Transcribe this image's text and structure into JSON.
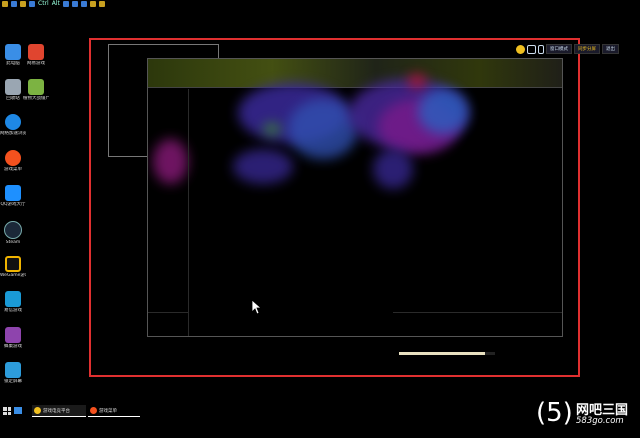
{
  "top_toolbar": {
    "text_ctrl": "Ctrl",
    "text_alt": "Alt"
  },
  "desktop_icons": [
    {
      "label": "此电脑",
      "icon": "computer-icon",
      "color": "#3a8ee6"
    },
    {
      "label": "网易游戏",
      "icon": "game-platform-icon",
      "color": "#e0452f"
    },
    {
      "label": "回收站",
      "icon": "recycle-bin-icon",
      "color": "#9aa6b2"
    },
    {
      "label": "植物大战僵尸",
      "icon": "plants-vs-zombies-icon",
      "color": "#7cb342"
    },
    {
      "label": "网络加速浏览器",
      "icon": "browser-icon",
      "color": "#1e88e5"
    },
    {
      "label": "游戏菜单",
      "icon": "game-menu-icon",
      "color": "#f4511e"
    },
    {
      "label": "QQ游戏大厅",
      "icon": "qq-icon",
      "color": "#1e90ff"
    },
    {
      "label": "Steam",
      "icon": "steam-icon",
      "color": "#1b2838"
    },
    {
      "label": "WeGame游戏平台",
      "icon": "wegame-icon",
      "color": "#f0b400"
    },
    {
      "label": "易信游戏",
      "icon": "yixin-icon",
      "color": "#1a9ad6"
    },
    {
      "label": "蜂巢游戏",
      "icon": "hive-game-icon",
      "color": "#8e44ad"
    },
    {
      "label": "锁定屏幕",
      "icon": "lock-icon",
      "color": "#2d9cdb"
    }
  ],
  "overlay_toolbar": {
    "btn_mode": "窗口模式",
    "btn_sync": "同步分屏",
    "btn_exit": "退出"
  },
  "progress": {
    "fraction": 0.9
  },
  "taskbar": {
    "items": [
      {
        "label": "游戏电竞平台",
        "icon": "game-platform-icon",
        "color": "#f0c020"
      },
      {
        "label": "游戏菜单",
        "icon": "game-menu-icon",
        "color": "#f4511e"
      }
    ]
  },
  "watermark": {
    "number": "(5)",
    "brand": "网吧三国",
    "url": "583go.com"
  }
}
